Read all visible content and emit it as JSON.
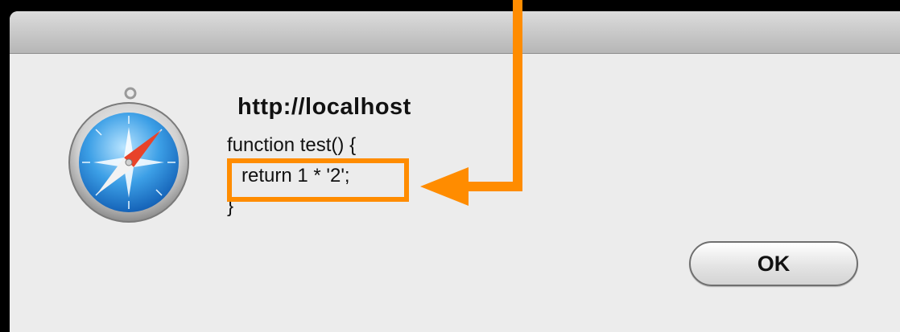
{
  "dialog": {
    "title": "http://localhost",
    "message_lines": [
      "function test() {",
      "return 1 * '2';",
      "}"
    ],
    "ok_label": "OK"
  },
  "app_icon": "safari-compass-icon",
  "colors": {
    "callout": "#ff8c00",
    "dialog_background": "#ececec",
    "screen_background": "#000000"
  }
}
